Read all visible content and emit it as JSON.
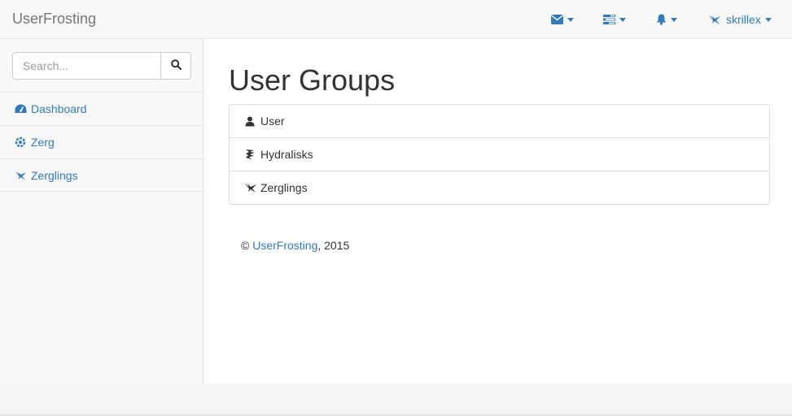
{
  "navbar": {
    "brand": "UserFrosting",
    "items": [
      {
        "icon": "envelope-icon"
      },
      {
        "icon": "tasks-icon"
      },
      {
        "icon": "bell-icon"
      },
      {
        "icon": "zergling-icon",
        "label": "skrillex"
      }
    ]
  },
  "sidebar": {
    "search": {
      "placeholder": "Search...",
      "value": ""
    },
    "items": [
      {
        "icon": "dashboard-icon",
        "label": "Dashboard"
      },
      {
        "icon": "zerg-icon",
        "label": "Zerg"
      },
      {
        "icon": "zergling-icon",
        "label": "Zerglings"
      }
    ]
  },
  "main": {
    "title": "User Groups",
    "groups": [
      {
        "icon": "user-icon",
        "label": "User"
      },
      {
        "icon": "hydralisk-icon",
        "label": "Hydralisks"
      },
      {
        "icon": "zergling-icon",
        "label": "Zerglings"
      }
    ],
    "footer": {
      "copyright": "©",
      "link": "UserFrosting",
      "year": ", 2015"
    }
  },
  "colors": {
    "link": "#337ab7",
    "brand": "#777777",
    "navbar_bg": "#f8f8f8",
    "border": "#e7e7e7"
  }
}
